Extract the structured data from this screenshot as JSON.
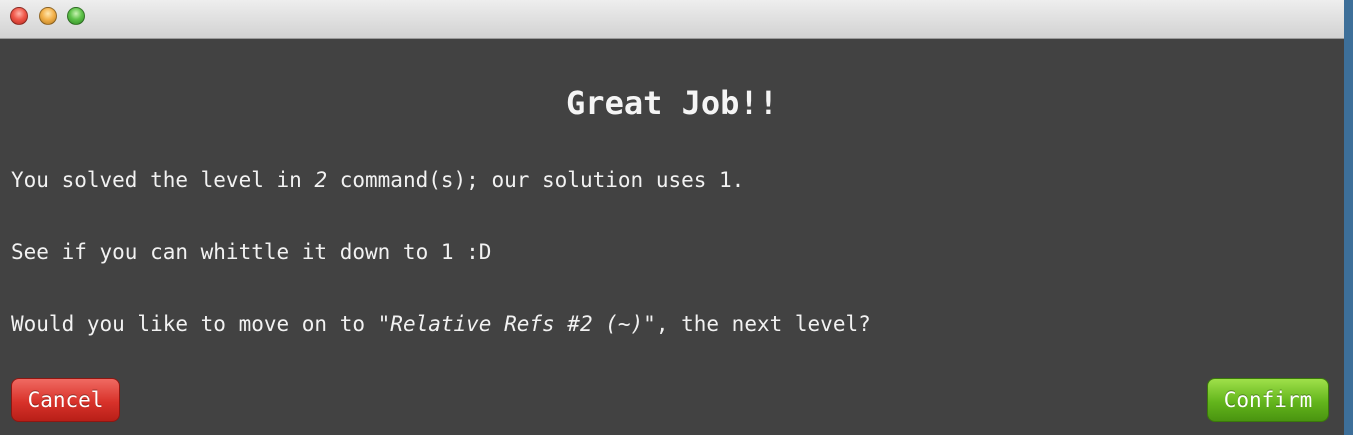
{
  "dialog": {
    "title": "Great Job!!",
    "line1": {
      "prefix": "You solved the level in ",
      "count": "2",
      "suffix": " command(s); our solution uses 1."
    },
    "line2": "See if you can whittle it down to 1 :D",
    "line3": {
      "prefix": "Would you like to move on to ",
      "level_name": "\"Relative Refs #2 (~)\"",
      "suffix": ", the next level?"
    },
    "cancel_label": "Cancel",
    "confirm_label": "Confirm"
  },
  "colors": {
    "background": "#424242",
    "text": "#f2f2f2",
    "cancel": "#d8322a",
    "confirm": "#63b51c"
  }
}
